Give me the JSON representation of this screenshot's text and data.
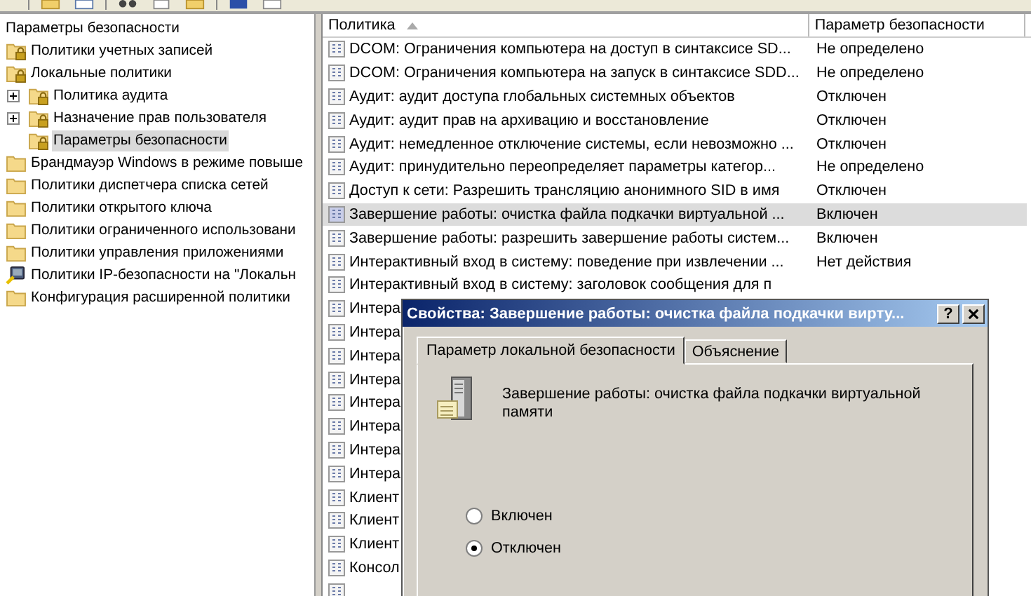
{
  "tree": {
    "root": "Параметры безопасности",
    "items": [
      {
        "label": "Политики учетных записей",
        "kind": "locked",
        "selected": false
      },
      {
        "label": "Локальные политики",
        "kind": "locked",
        "selected": false,
        "children": [
          {
            "label": "Политика аудита",
            "kind": "locked",
            "expandable": true,
            "selected": false
          },
          {
            "label": "Назначение прав пользователя",
            "kind": "locked",
            "expandable": true,
            "selected": false
          },
          {
            "label": "Параметры безопасности",
            "kind": "locked",
            "expandable": false,
            "selected": true
          }
        ]
      },
      {
        "label": "Брандмауэр Windows в режиме повыше",
        "kind": "folder",
        "selected": false
      },
      {
        "label": "Политики диспетчера списка сетей",
        "kind": "folder",
        "selected": false
      },
      {
        "label": "Политики открытого ключа",
        "kind": "folder",
        "selected": false
      },
      {
        "label": "Политики ограниченного использовани",
        "kind": "folder",
        "selected": false
      },
      {
        "label": "Политики управления приложениями",
        "kind": "folder",
        "selected": false
      },
      {
        "label": "Политики IP-безопасности на \"Локальн",
        "kind": "network",
        "selected": false
      },
      {
        "label": "Конфигурация расширенной политики",
        "kind": "folder",
        "selected": false
      }
    ]
  },
  "table": {
    "columns": [
      "Политика",
      "Параметр безопасности"
    ],
    "rows": [
      {
        "policy": "DCOM: Ограничения компьютера на доступ в синтаксисе SD...",
        "setting": "Не определено",
        "selected": false
      },
      {
        "policy": "DCOM: Ограничения компьютера на запуск в синтаксисе SDD...",
        "setting": "Не определено",
        "selected": false
      },
      {
        "policy": "Аудит: аудит доступа глобальных системных объектов",
        "setting": "Отключен",
        "selected": false
      },
      {
        "policy": "Аудит: аудит прав на архивацию и восстановление",
        "setting": "Отключен",
        "selected": false
      },
      {
        "policy": "Аудит: немедленное отключение системы, если невозможно ...",
        "setting": "Отключен",
        "selected": false
      },
      {
        "policy": "Аудит: принудительно переопределяет параметры категор...",
        "setting": "Не определено",
        "selected": false
      },
      {
        "policy": "Доступ к сети: Разрешить трансляцию анонимного SID в имя",
        "setting": "Отключен",
        "selected": false
      },
      {
        "policy": "Завершение работы: очистка файла подкачки виртуальной ...",
        "setting": "Включен",
        "selected": true
      },
      {
        "policy": "Завершение работы: разрешить завершение работы систем...",
        "setting": "Включен",
        "selected": false
      },
      {
        "policy": "Интерактивный вход в систему:  поведение при извлечении ...",
        "setting": "Нет действия",
        "selected": false
      },
      {
        "policy": "Интерактивный вход в систему: заголовок сообщения для п",
        "selected": false
      },
      {
        "policy": "Интера",
        "selected": false
      },
      {
        "policy": "Интера",
        "selected": false
      },
      {
        "policy": "Интера",
        "selected": false
      },
      {
        "policy": "Интера",
        "selected": false
      },
      {
        "policy": "Интера",
        "selected": false
      },
      {
        "policy": "Интера",
        "selected": false
      },
      {
        "policy": "Интера",
        "selected": false
      },
      {
        "policy": "Интера",
        "selected": false
      },
      {
        "policy": "Клиент",
        "selected": false
      },
      {
        "policy": "Клиент",
        "selected": false
      },
      {
        "policy": "Клиент",
        "selected": false
      },
      {
        "policy": "Консол",
        "selected": false
      },
      {
        "selected": false
      }
    ]
  },
  "dialog": {
    "title": "Свойства: Завершение работы: очистка файла подкачки вирту...",
    "help_button": "?",
    "tabs": [
      {
        "label": "Параметр локальной безопасности",
        "selected": true
      },
      {
        "label": "Объяснение",
        "selected": false
      }
    ],
    "policy_name": "Завершение работы: очистка файла подкачки виртуальной памяти",
    "options": [
      {
        "label": "Включен",
        "selected": false
      },
      {
        "label": "Отключен",
        "selected": true
      }
    ]
  }
}
